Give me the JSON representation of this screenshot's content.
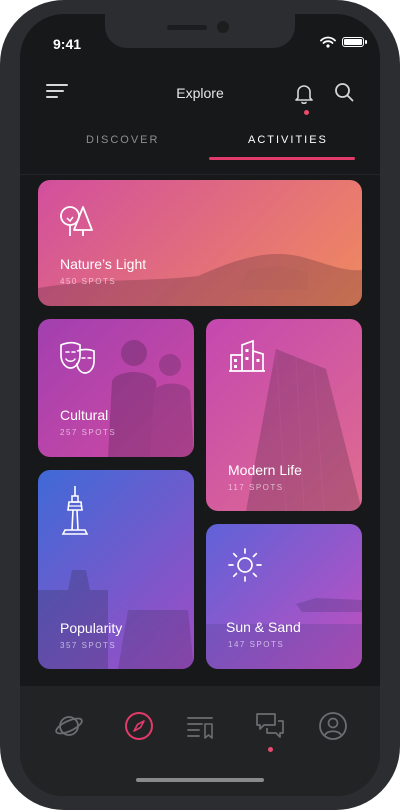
{
  "status": {
    "time": "9:41"
  },
  "header": {
    "title": "Explore"
  },
  "tabs": [
    {
      "label": "DISCOVER",
      "active": false
    },
    {
      "label": "ACTIVITIES",
      "active": true
    }
  ],
  "cards": [
    {
      "title": "Nature’s Light",
      "spots": "450 SPOTS",
      "icon": "trees-icon",
      "gradient": [
        "#d24f9e",
        "#f08a5d"
      ]
    },
    {
      "title": "Cultural",
      "spots": "257 SPOTS",
      "icon": "theater-masks-icon",
      "gradient": [
        "#a23fb0",
        "#d04ba2"
      ]
    },
    {
      "title": "Modern Life",
      "spots": "117 SPOTS",
      "icon": "buildings-icon",
      "gradient": [
        "#c448b0",
        "#e06c8f"
      ]
    },
    {
      "title": "Popularity",
      "spots": "357 SPOTS",
      "icon": "tower-icon",
      "gradient": [
        "#3f6ad7",
        "#a14cc3"
      ]
    },
    {
      "title": "Sun & Sand",
      "spots": "147 SPOTS",
      "icon": "sun-icon",
      "gradient": [
        "#5f62d8",
        "#c24fbf"
      ]
    }
  ],
  "bottom_nav": [
    {
      "name": "explore-planet-icon",
      "active": false
    },
    {
      "name": "compass-icon",
      "active": true
    },
    {
      "name": "bookmarks-icon",
      "active": false
    },
    {
      "name": "messages-icon",
      "active": false,
      "badge": true
    },
    {
      "name": "profile-icon",
      "active": false
    }
  ],
  "colors": {
    "accent": "#e23a6b",
    "background": "#17181a"
  }
}
